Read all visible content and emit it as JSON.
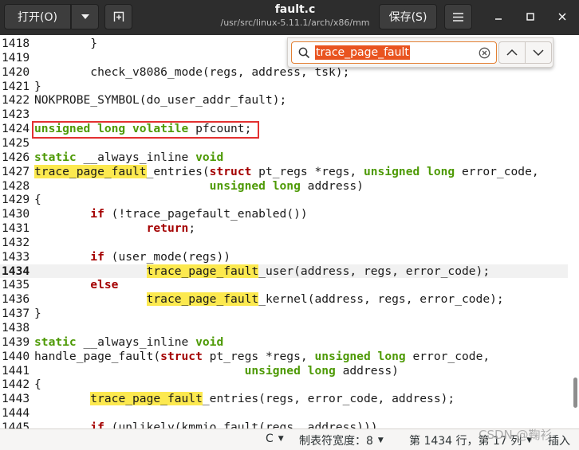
{
  "header": {
    "open_label": "打开(O)",
    "title": "fault.c",
    "path": "/usr/src/linux-5.11.1/arch/x86/mm",
    "save_label": "保存(S)"
  },
  "search": {
    "query": "trace_page_fault"
  },
  "statusbar": {
    "language": "C",
    "tab_width": "制表符宽度：8",
    "position": "第 1434 行，第 17 列",
    "insert_mode": "插入"
  },
  "watermark": "CSDN @鞠衫",
  "current_line": "1434",
  "lines": [
    {
      "n": "1418",
      "tokens": [
        {
          "t": "        }"
        }
      ]
    },
    {
      "n": "1419",
      "tokens": []
    },
    {
      "n": "1420",
      "tokens": [
        {
          "t": "        check_v8086_mode(regs, address, tsk);"
        }
      ]
    },
    {
      "n": "1421",
      "tokens": [
        {
          "t": "}"
        }
      ]
    },
    {
      "n": "1422",
      "tokens": [
        {
          "t": "NOKPROBE_SYMBOL(do_user_addr_fault);"
        }
      ]
    },
    {
      "n": "1423",
      "tokens": []
    },
    {
      "n": "1424",
      "tokens": [
        {
          "t": "unsigned long volatile",
          "c": "kw"
        },
        {
          "t": " pfcount;"
        }
      ]
    },
    {
      "n": "1425",
      "tokens": []
    },
    {
      "n": "1426",
      "tokens": [
        {
          "t": "static",
          "c": "kw"
        },
        {
          "t": " __always_inline "
        },
        {
          "t": "void",
          "c": "kw"
        }
      ]
    },
    {
      "n": "1427",
      "tokens": [
        {
          "t": "trace_page_fault",
          "c": "hl"
        },
        {
          "t": "_entries("
        },
        {
          "t": "struct",
          "c": "ctl"
        },
        {
          "t": " pt_regs *regs, "
        },
        {
          "t": "unsigned long",
          "c": "kw"
        },
        {
          "t": " error_code,"
        }
      ]
    },
    {
      "n": "1428",
      "tokens": [
        {
          "t": "                         "
        },
        {
          "t": "unsigned long",
          "c": "kw"
        },
        {
          "t": " address)"
        }
      ]
    },
    {
      "n": "1429",
      "tokens": [
        {
          "t": "{"
        }
      ]
    },
    {
      "n": "1430",
      "tokens": [
        {
          "t": "        "
        },
        {
          "t": "if",
          "c": "ctl"
        },
        {
          "t": " (!trace_pagefault_enabled())"
        }
      ]
    },
    {
      "n": "1431",
      "tokens": [
        {
          "t": "                "
        },
        {
          "t": "return",
          "c": "ctl"
        },
        {
          "t": ";"
        }
      ]
    },
    {
      "n": "1432",
      "tokens": []
    },
    {
      "n": "1433",
      "tokens": [
        {
          "t": "        "
        },
        {
          "t": "if",
          "c": "ctl"
        },
        {
          "t": " (user_mode(regs))"
        }
      ]
    },
    {
      "n": "1434",
      "tokens": [
        {
          "t": "                "
        },
        {
          "t": "trace_page_fault",
          "c": "hl"
        },
        {
          "t": "_user(address, regs, error_code);"
        }
      ]
    },
    {
      "n": "1435",
      "tokens": [
        {
          "t": "        "
        },
        {
          "t": "else",
          "c": "ctl"
        }
      ]
    },
    {
      "n": "1436",
      "tokens": [
        {
          "t": "                "
        },
        {
          "t": "trace_page_fault",
          "c": "hl"
        },
        {
          "t": "_kernel(address, regs, error_code);"
        }
      ]
    },
    {
      "n": "1437",
      "tokens": [
        {
          "t": "}"
        }
      ]
    },
    {
      "n": "1438",
      "tokens": []
    },
    {
      "n": "1439",
      "tokens": [
        {
          "t": "static",
          "c": "kw"
        },
        {
          "t": " __always_inline "
        },
        {
          "t": "void",
          "c": "kw"
        }
      ]
    },
    {
      "n": "1440",
      "tokens": [
        {
          "t": "handle_page_fault("
        },
        {
          "t": "struct",
          "c": "ctl"
        },
        {
          "t": " pt_regs *regs, "
        },
        {
          "t": "unsigned long",
          "c": "kw"
        },
        {
          "t": " error_code,"
        }
      ]
    },
    {
      "n": "1441",
      "tokens": [
        {
          "t": "                              "
        },
        {
          "t": "unsigned long",
          "c": "kw"
        },
        {
          "t": " address)"
        }
      ]
    },
    {
      "n": "1442",
      "tokens": [
        {
          "t": "{"
        }
      ]
    },
    {
      "n": "1443",
      "tokens": [
        {
          "t": "        "
        },
        {
          "t": "trace_page_fault",
          "c": "hl"
        },
        {
          "t": "_entries(regs, error_code, address);"
        }
      ]
    },
    {
      "n": "1444",
      "tokens": []
    },
    {
      "n": "1445",
      "tokens": [
        {
          "t": "        "
        },
        {
          "t": "if",
          "c": "ctl"
        },
        {
          "t": " (unlikely(kmmio_fault(regs, address)))"
        }
      ]
    }
  ]
}
